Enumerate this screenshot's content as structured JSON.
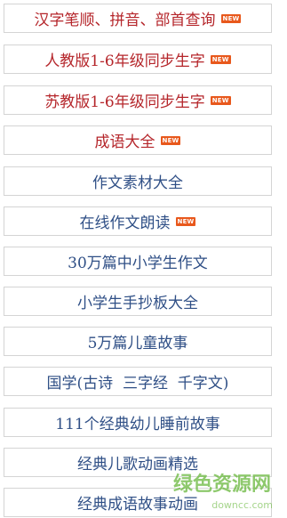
{
  "menu": {
    "items": [
      {
        "label": "汉字笔顺、拼音、部首查询",
        "badge": "NEW"
      },
      {
        "label": "人教版1-6年级同步生字",
        "badge": "NEW"
      },
      {
        "label": "苏教版1-6年级同步生字",
        "badge": "NEW"
      },
      {
        "label": "成语大全",
        "badge": "NEW"
      },
      {
        "label": "作文素材大全"
      },
      {
        "label": "在线作文朗读",
        "badge": "NEW"
      },
      {
        "label": "30万篇中小学生作文"
      },
      {
        "label": "小学生手抄板大全"
      },
      {
        "label": "5万篇儿童故事"
      },
      {
        "label": "国学(古诗  三字经  千字文)"
      },
      {
        "label": "111个经典幼儿睡前故事"
      },
      {
        "label": "经典儿歌动画精选"
      },
      {
        "label": "经典成语故事动画"
      }
    ]
  },
  "watermark": {
    "text": "绿色资源网",
    "url": "downcc.com"
  },
  "colors": {
    "red": "#b5262b",
    "blue": "#2f4f86",
    "badge": "#e8581c",
    "watermark": "#69b83d"
  }
}
